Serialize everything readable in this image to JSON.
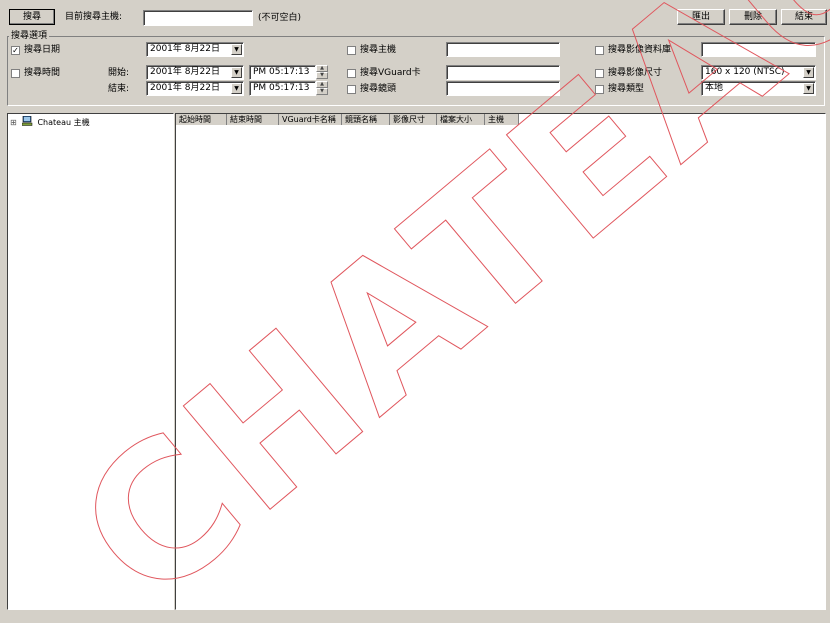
{
  "toolbar": {
    "search_label": "搜尋",
    "current_host_label": "目前搜尋主機:",
    "current_host_value": "",
    "not_empty_hint": "(不可空白)",
    "export_label": "匯出",
    "delete_label": "刪除",
    "exit_label": "結束"
  },
  "options": {
    "group_title": "搜尋選項",
    "search_date_label": "搜尋日期",
    "search_date_checked": true,
    "search_date_value": "2001年 8月22日",
    "search_time_label": "搜尋時間",
    "search_time_checked": false,
    "start_label": "開始:",
    "start_date_value": "2001年 8月22日",
    "start_time_value": "PM 05:17:13",
    "end_label": "結束:",
    "end_date_value": "2001年 8月22日",
    "end_time_value": "PM 05:17:13",
    "search_host_label": "搜尋主機",
    "search_host_value": "",
    "search_vguard_label": "搜尋VGuard卡",
    "search_vguard_value": "",
    "search_lens_label": "搜尋鏡頭",
    "search_lens_value": "",
    "search_db_label": "搜尋影像資料庫",
    "search_db_value": "",
    "search_size_label": "搜尋影像尺寸",
    "search_size_value": "160 x 120 (NTSC)",
    "search_type_label": "搜尋類型",
    "search_type_value": "本地"
  },
  "tree": {
    "expand_glyph": "⊞",
    "root_label": "Chateau 主機"
  },
  "table": {
    "columns": [
      "起始時間",
      "結束時間",
      "VGuard卡名稱",
      "鏡頭名稱",
      "影像尺寸",
      "檔案大小",
      "主機"
    ]
  },
  "watermark": "CHATEAU"
}
